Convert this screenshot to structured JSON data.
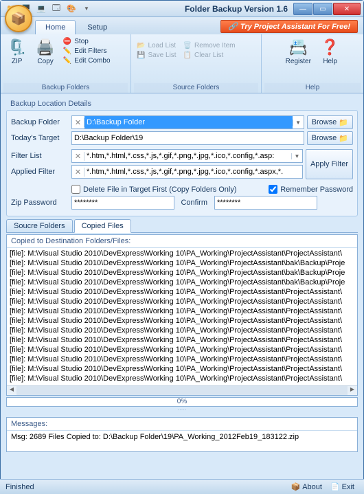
{
  "title": "Folder Backup Version 1.6",
  "promo": "Try Project Assistant For Free!",
  "tabs": {
    "home": "Home",
    "setup": "Setup"
  },
  "ribbon": {
    "backup_group": "Backup Folders",
    "source_group": "Source Folders",
    "help_group": "Help",
    "zip": "ZIP",
    "copy": "Copy",
    "stop": "Stop",
    "edit_filters": "Edit Filters",
    "edit_combo": "Edit Combo",
    "load_list": "Load List",
    "save_list": "Save List",
    "remove_item": "Remove Item",
    "clear_list": "Clear List",
    "register": "Register",
    "help": "Help"
  },
  "details": {
    "title": "Backup Location Details",
    "backup_folder_label": "Backup Folder",
    "backup_folder_value": "D:\\Backup Folder",
    "target_label": "Today's Target",
    "target_value": "D:\\Backup Folder\\19",
    "filter_list_label": "Filter List",
    "filter_list_value": "*.htm,*.html,*.css,*.js,*.gif,*.png,*.jpg,*.ico,*.config,*.asp:",
    "applied_filter_label": "Applied Filter",
    "applied_filter_value": "*.htm,*.html,*.css,*.js,*.gif,*.png,*.jpg,*.ico,*.config,*.aspx,*.",
    "browse": "Browse",
    "apply_filter": "Apply Filter",
    "delete_first": "Delete File in Target First (Copy Folders Only)",
    "remember_pw": "Remember Password",
    "remember_checked": true,
    "zip_pw_label": "Zip Password",
    "zip_pw_value": "********",
    "confirm_label": "Confirm",
    "confirm_value": "********"
  },
  "tabs2": {
    "source": "Soucre Folders",
    "copied": "Copied Files"
  },
  "loglist": {
    "header": "Copied to Destination Folders/Files:",
    "rows": [
      "[file]: M:\\Visual Studio 2010\\DevExpress\\Working 10\\PA_Working\\ProjectAssistant\\ProjectAssistant\\",
      "[file]: M:\\Visual Studio 2010\\DevExpress\\Working 10\\PA_Working\\ProjectAssistant\\bak\\Backup\\Proje",
      "[file]: M:\\Visual Studio 2010\\DevExpress\\Working 10\\PA_Working\\ProjectAssistant\\bak\\Backup\\Proje",
      "[file]: M:\\Visual Studio 2010\\DevExpress\\Working 10\\PA_Working\\ProjectAssistant\\bak\\Backup\\Proje",
      "[file]: M:\\Visual Studio 2010\\DevExpress\\Working 10\\PA_Working\\ProjectAssistant\\ProjectAssistant\\",
      "[file]: M:\\Visual Studio 2010\\DevExpress\\Working 10\\PA_Working\\ProjectAssistant\\ProjectAssistant\\",
      "[file]: M:\\Visual Studio 2010\\DevExpress\\Working 10\\PA_Working\\ProjectAssistant\\ProjectAssistant\\",
      "[file]: M:\\Visual Studio 2010\\DevExpress\\Working 10\\PA_Working\\ProjectAssistant\\ProjectAssistant\\",
      "[file]: M:\\Visual Studio 2010\\DevExpress\\Working 10\\PA_Working\\ProjectAssistant\\ProjectAssistant\\",
      "[file]: M:\\Visual Studio 2010\\DevExpress\\Working 10\\PA_Working\\ProjectAssistant\\ProjectAssistant\\",
      "[file]: M:\\Visual Studio 2010\\DevExpress\\Working 10\\PA_Working\\ProjectAssistant\\ProjectAssistant\\",
      "[file]: M:\\Visual Studio 2010\\DevExpress\\Working 10\\PA_Working\\ProjectAssistant\\ProjectAssistant\\",
      "[file]: M:\\Visual Studio 2010\\DevExpress\\Working 10\\PA_Working\\ProjectAssistant\\ProjectAssistant\\",
      "[file]: M:\\Visual Studio 2010\\DevExpress\\Working 10\\PA_Working\\ProjectAssistant\\ProjectAssistant\\"
    ]
  },
  "progress": "0%",
  "messages": {
    "header": "Messages:",
    "text": "Msg: 2689 Files Copied to: D:\\Backup Folder\\19\\PA_Working_2012Feb19_183122.zip"
  },
  "status": {
    "left": "Finished",
    "about": "About",
    "exit": "Exit"
  }
}
